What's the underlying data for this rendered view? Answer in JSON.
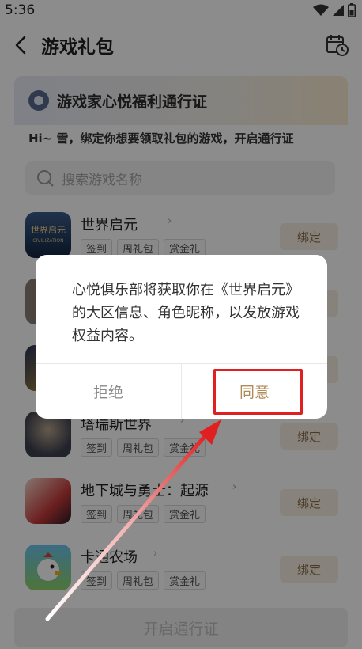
{
  "status_bar": {
    "time": "5:36",
    "icons": [
      "wifi-icon",
      "signal-icon",
      "battery-icon"
    ]
  },
  "header": {
    "title": "游戏礼包",
    "right_icon": "calendar-clock-icon"
  },
  "pass": {
    "title": "游戏家心悦福利通行证",
    "subtitle": "Hi~ 雪，绑定你想要领取礼包的游戏，开启通行证"
  },
  "search": {
    "placeholder": "搜索游戏名称"
  },
  "games": [
    {
      "name": "世界启元",
      "tags": [
        "签到",
        "周礼包",
        "赏金礼"
      ],
      "bind_label": "绑定"
    },
    {
      "name": "塔瑞斯世界",
      "tags": [
        "签到",
        "周礼包",
        "赏金礼"
      ],
      "bind_label": "绑定"
    },
    {
      "name": "地下城与勇士：起源",
      "tags": [
        "签到",
        "周礼包",
        "赏金礼"
      ],
      "bind_label": "绑定"
    },
    {
      "name": "卡通农场",
      "tags": [
        "签到",
        "周礼包",
        "赏金礼"
      ],
      "bind_label": "绑定"
    }
  ],
  "footer": {
    "open_pass_label": "开启通行证"
  },
  "dialog": {
    "message": "心悦俱乐部将获取你在《世界启元》的大区信息、角色昵称，以发放游戏权益内容。",
    "reject_label": "拒绝",
    "agree_label": "同意"
  },
  "colors": {
    "accent_gold": "#b08a57",
    "annotation_red": "#e02020",
    "bind_bg": "#f6eee2"
  }
}
